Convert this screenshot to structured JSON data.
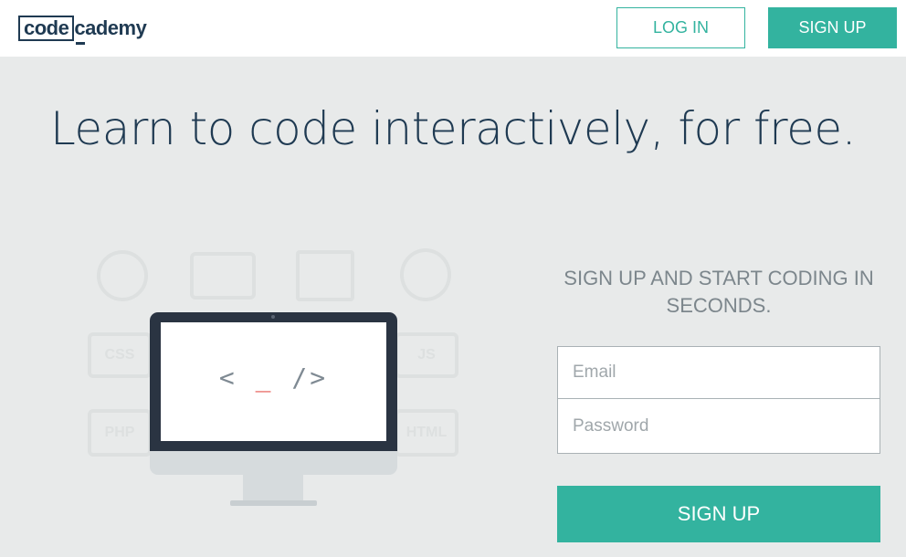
{
  "header": {
    "logo_part1": "code",
    "logo_part2": "cademy",
    "login_label": "LOG IN",
    "signup_label": "SIGN UP"
  },
  "hero": {
    "headline": "Learn to code interactively, for free."
  },
  "illustration": {
    "code_open": "< ",
    "code_cursor": "_",
    "code_close": " />",
    "bg_icon_labels": [
      "CSS",
      "PHP",
      "HTML",
      "JS"
    ]
  },
  "signup_form": {
    "heading": "SIGN UP AND START CODING IN SECONDS.",
    "email_placeholder": "Email",
    "password_placeholder": "Password",
    "submit_label": "SIGN UP"
  },
  "colors": {
    "accent": "#33b39f",
    "navy": "#1f3a52",
    "background": "#e8eaea",
    "cursor_red": "#e5554f"
  }
}
